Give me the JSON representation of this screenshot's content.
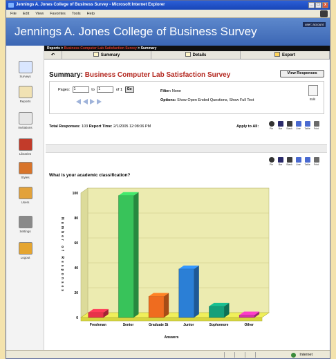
{
  "window": {
    "title": "Jennings A. Jones College of Business Survey - Microsoft Internet Explorer",
    "buttons": [
      "_",
      "□",
      "x"
    ]
  },
  "menu": [
    "File",
    "Edit",
    "View",
    "Favorites",
    "Tools",
    "Help"
  ],
  "banner": {
    "title": "Jennings A. Jones College of Business Survey",
    "user_label": "user: account"
  },
  "breadcrumb": {
    "root": "Reports >",
    "survey": "Business Computer Lab Satisfaction Survey",
    "current": "> Summary"
  },
  "tabs": [
    "Summary",
    "Details",
    "Export"
  ],
  "sidebar": [
    {
      "label": "Surveys",
      "color": "#d9e6ff"
    },
    {
      "label": "Reports",
      "color": "#f1e2b3"
    },
    {
      "label": "Invitations",
      "color": "#e6e6e6"
    },
    {
      "label": "Libraries",
      "color": "#c23b2a"
    },
    {
      "label": "Styles",
      "color": "#d8742a"
    },
    {
      "label": "Users",
      "color": "#e2a23b"
    },
    {
      "label": "Settings",
      "color": "#8a8a8a"
    },
    {
      "label": "Logout",
      "color": "#e5a530"
    }
  ],
  "summary": {
    "label": "Summary:",
    "survey_name": "Business Computer Lab Satisfaction Survey",
    "view_responses": "View Responses"
  },
  "pager": {
    "pages_label": "Pages:",
    "page_from": "1",
    "to_label": "to",
    "page_to": "1",
    "of_label": "of 1",
    "go": "Go"
  },
  "filter": {
    "filter_label": "Filter:",
    "filter_value": "None",
    "options_label": "Options:",
    "options_value": "Show Open Ended Questions, Show Full Text",
    "edit": "Edit"
  },
  "totals": {
    "responses_label": "Total Responses:",
    "responses": "103",
    "time_label": "Report Time:",
    "time": "2/1/2005 12:08:06 PM",
    "apply_all": "Apply to All:"
  },
  "chart_icons": [
    "Pie",
    "Bar",
    "Stack",
    "Line",
    "Table",
    "Print"
  ],
  "question": "What is your academic classification?",
  "chart_data": {
    "type": "bar",
    "categories": [
      "Freshman",
      "Senior",
      "Graduate St",
      "Junior",
      "Sophomore",
      "Other"
    ],
    "values": [
      4,
      98,
      17,
      39,
      9,
      2
    ],
    "colors": [
      "#e8334a",
      "#38c35a",
      "#ef6c1f",
      "#2b7fd6",
      "#15a07a",
      "#d433a8"
    ],
    "ylabel": "Number of Responses",
    "xlabel": "Answers",
    "yticks": [
      0,
      20,
      40,
      60,
      80,
      100
    ],
    "ylim": [
      0,
      100
    ],
    "grid": true
  },
  "status": {
    "zone": "Internet"
  }
}
